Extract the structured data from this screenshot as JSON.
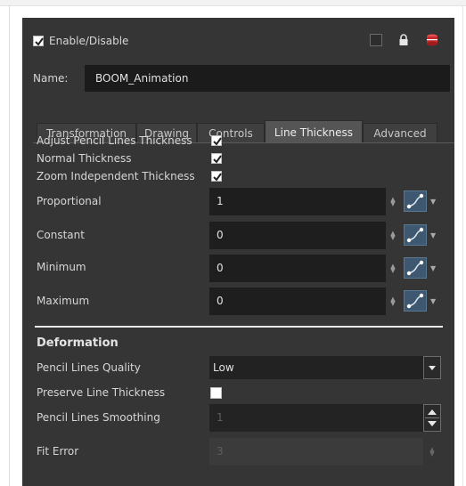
{
  "header": {
    "enable_label": "Enable/Disable",
    "name_label": "Name:",
    "name_value": "BOOM_Animation"
  },
  "tabs": [
    {
      "label": "Transformation",
      "active": false
    },
    {
      "label": "Drawing",
      "active": false
    },
    {
      "label": "Controls",
      "active": false
    },
    {
      "label": "Line Thickness",
      "active": true
    },
    {
      "label": "Advanced",
      "active": false
    }
  ],
  "checks": {
    "adjust_label": "Adjust Pencil Lines Thickness",
    "normal_label": "Normal Thickness",
    "zoom_label": "Zoom Independent Thickness"
  },
  "params": {
    "proportional": {
      "label": "Proportional",
      "value": "1"
    },
    "constant": {
      "label": "Constant",
      "value": "0"
    },
    "minimum": {
      "label": "Minimum",
      "value": "0"
    },
    "maximum": {
      "label": "Maximum",
      "value": "0"
    }
  },
  "deformation": {
    "title": "Deformation",
    "quality_label": "Pencil Lines Quality",
    "quality_value": "Low",
    "preserve_label": "Preserve Line Thickness",
    "smoothing_label": "Pencil Lines Smoothing",
    "smoothing_value": "1",
    "fit_label": "Fit Error",
    "fit_value": "3"
  },
  "icons": [
    "checkbox-icon",
    "lock-icon",
    "layer-color-icon",
    "function-curve-icon",
    "dropdown-arrow-icon"
  ],
  "colors": {
    "panel": "#353535",
    "field": "#1e1e1e",
    "function_button": "#3d5870"
  }
}
